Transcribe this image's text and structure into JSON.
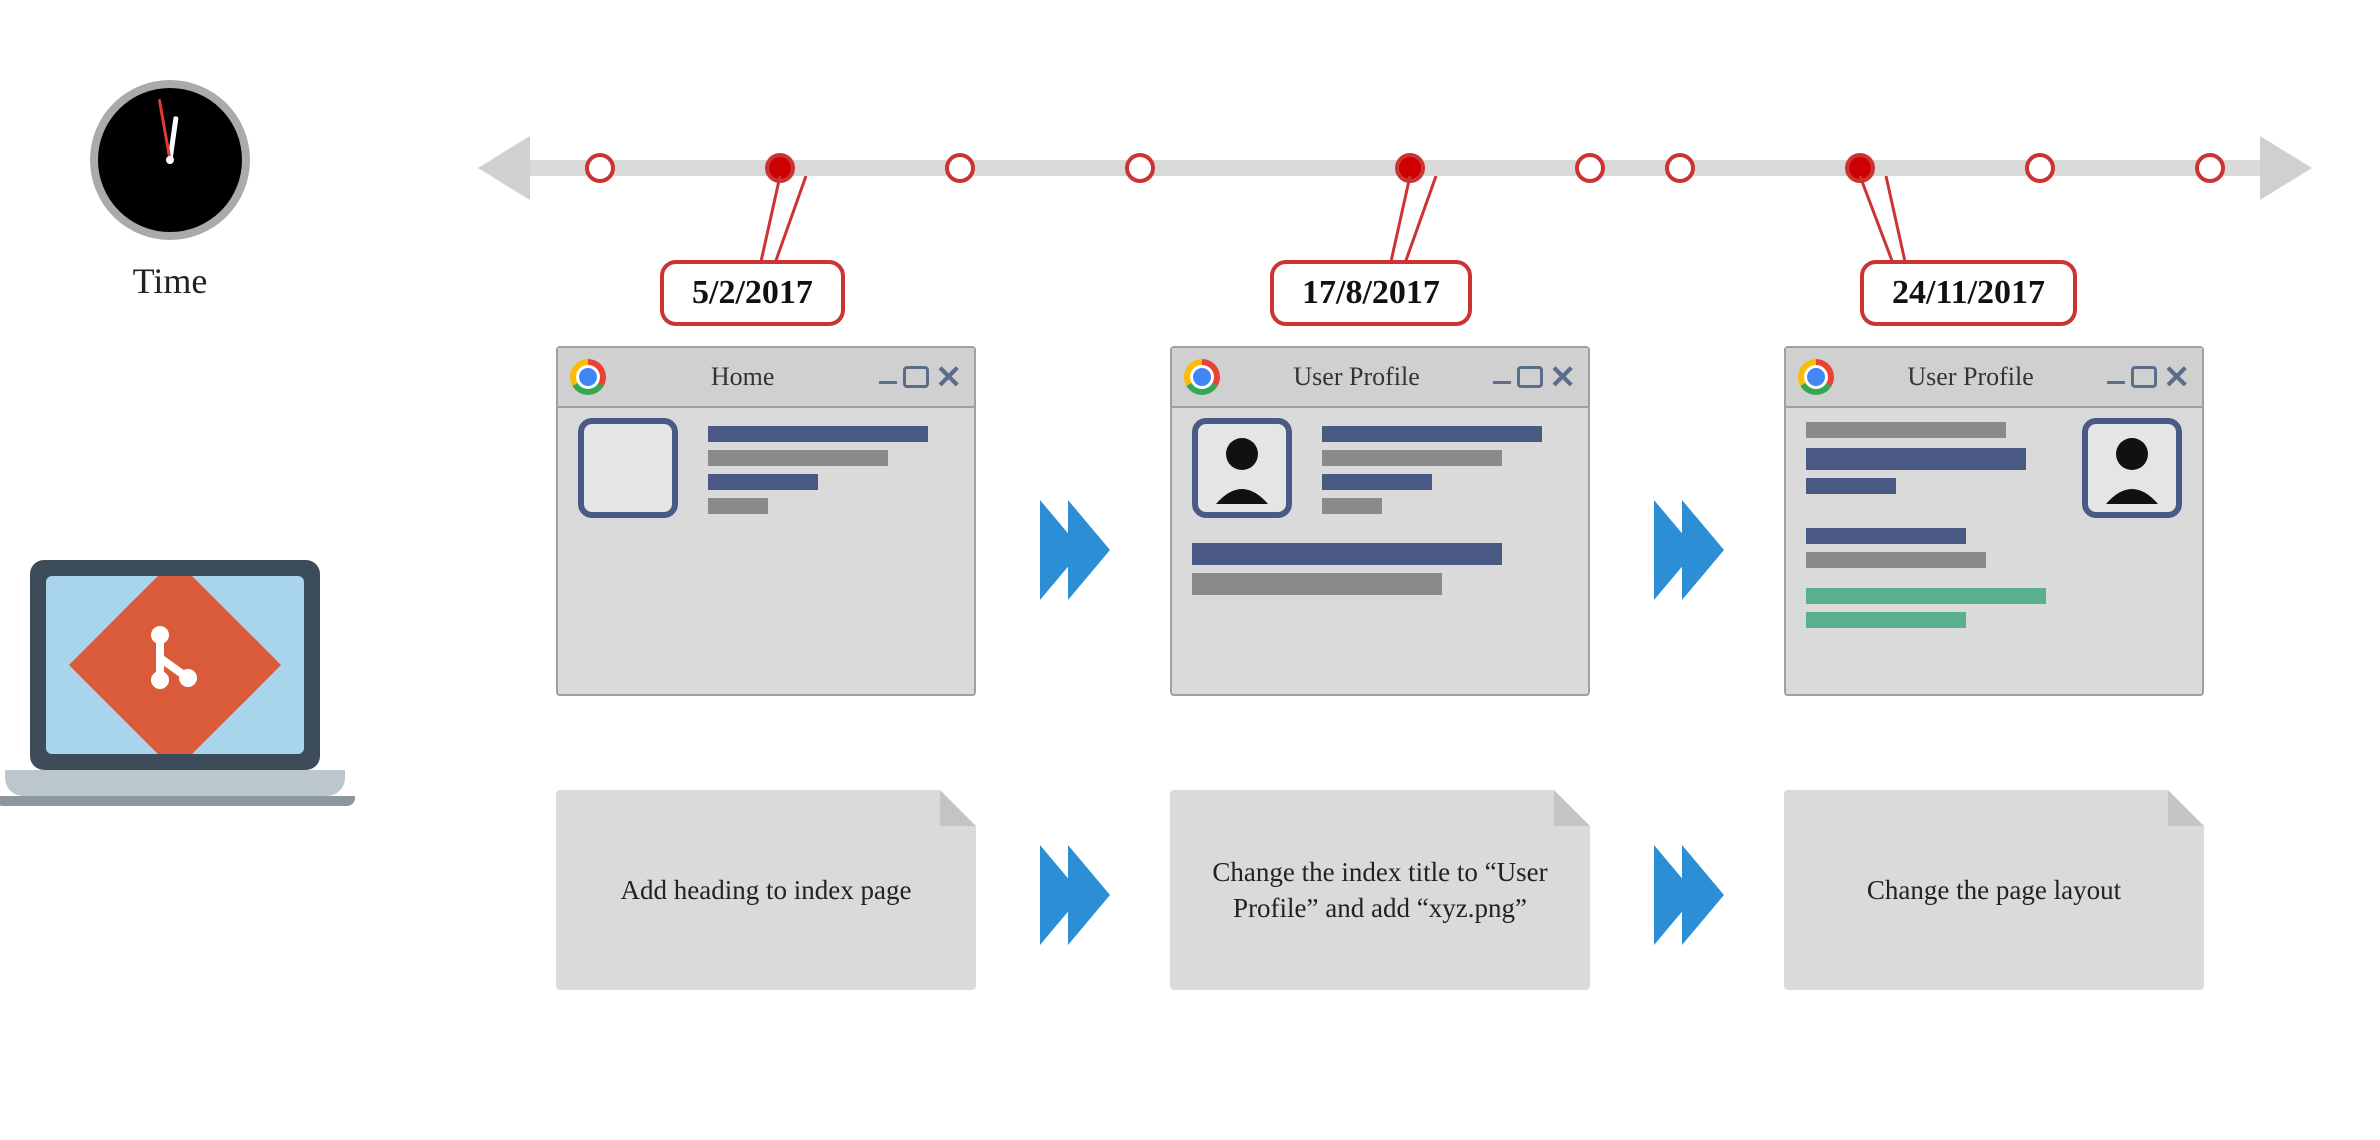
{
  "time_label": "Time",
  "timeline": {
    "dots": [
      {
        "pos": 110,
        "filled": false
      },
      {
        "pos": 290,
        "filled": true
      },
      {
        "pos": 470,
        "filled": false
      },
      {
        "pos": 650,
        "filled": false
      },
      {
        "pos": 830,
        "filled": true
      },
      {
        "pos": 1010,
        "filled": false
      },
      {
        "pos": 1190,
        "filled": false
      },
      {
        "pos": 1370,
        "filled": true
      },
      {
        "pos": 1550,
        "filled": false
      },
      {
        "pos": 1720,
        "filled": false
      }
    ],
    "callouts": [
      {
        "date": "5/2/2017"
      },
      {
        "date": "17/8/2017"
      },
      {
        "date": "24/11/2017"
      }
    ]
  },
  "browsers": [
    {
      "title": "Home"
    },
    {
      "title": "User Profile"
    },
    {
      "title": "User Profile"
    }
  ],
  "notes": [
    "Add heading to index page",
    "Change the index title to “User Profile” and add “xyz.png”",
    "Change the page layout"
  ]
}
